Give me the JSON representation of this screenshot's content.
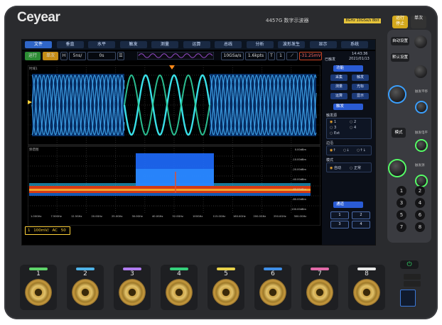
{
  "brand": {
    "name": "Ceyear"
  },
  "model": {
    "title": "4457G 数字示波器",
    "badge": "8GHz 10GSa/s 8bit"
  },
  "hw_buttons": {
    "run_stop": "运行\n停止",
    "single": "单次"
  },
  "menu": [
    {
      "label": "文件",
      "active": true
    },
    {
      "label": "垂直"
    },
    {
      "label": "水平"
    },
    {
      "label": "触发"
    },
    {
      "label": "测量"
    },
    {
      "label": "运算"
    },
    {
      "label": "总线"
    },
    {
      "label": "分析"
    },
    {
      "label": "波形发生"
    },
    {
      "label": "显示"
    },
    {
      "label": "系统"
    }
  ],
  "status": {
    "run": "运行",
    "single": "单次",
    "h": "H",
    "timebase": "5ns/",
    "delay": "0s",
    "sample_rate": "10GSa/s",
    "memory": "1.6kpts",
    "trigger_t": "T",
    "trigger_ch": "1",
    "trigger_level": "-31.25mV"
  },
  "plots": {
    "time_label": "时域1",
    "freq_label": "频谱图",
    "freq_axis": [
      "1.00GHz",
      "7.50GHz",
      "12.5GHz",
      "20.0GHz",
      "25.0GHz",
      "30.0GHz",
      "40.0GHz",
      "52.0GHz",
      "100GHz",
      "115.0GHz",
      "160.0GHz",
      "200.0GHz",
      "250.0GHz",
      "300.0GHz"
    ],
    "db_axis": [
      "0.00dBm",
      "-10.00dBm",
      "-20.00dBm",
      "-40.00dBm",
      "-60.00dBm",
      "-80.00dBm",
      "-100.00dBm"
    ]
  },
  "right_panel": {
    "header_status": "已触发",
    "time": "14:43:36",
    "date": "2021/01/13",
    "func_header": "功能",
    "func_buttons": [
      "采集",
      "触发",
      "测量",
      "光标",
      "运算",
      "显示"
    ],
    "trigger_header": "触发",
    "trig_source_label": "触发源",
    "sources": [
      "1",
      "2",
      "3",
      "4",
      "Ext"
    ],
    "edge_label": "边沿",
    "edge_options": [
      "↑",
      "↓",
      "↑↓"
    ],
    "mode_label": "模式",
    "mode_options": [
      "自动",
      "正常"
    ],
    "channel_header": "通道",
    "channel_buttons": [
      "1",
      "2",
      "3",
      "4"
    ]
  },
  "channel_info": {
    "ch": "1",
    "scale": "100mV/",
    "coupling": "AC",
    "impedance": "50"
  },
  "side_labels": {
    "auto": "自动设置",
    "default": "默认设置",
    "mode": "模式",
    "h_label": "触发平移",
    "v_label": "触发电平",
    "v2": "触发源"
  },
  "num_buttons": [
    "1",
    "2",
    "3",
    "4",
    "5",
    "6",
    "7",
    "8"
  ],
  "channels": [
    {
      "num": "1",
      "color": "#5fd46a"
    },
    {
      "num": "2",
      "color": "#4fb3e8"
    },
    {
      "num": "3",
      "color": "#b07cf0"
    },
    {
      "num": "4",
      "color": "#35d07b"
    },
    {
      "num": "5",
      "color": "#e8d24a"
    },
    {
      "num": "6",
      "color": "#3f8fe8"
    },
    {
      "num": "7",
      "color": "#e26aa8"
    },
    {
      "num": "8",
      "color": "#e8e8e8"
    }
  ],
  "colors": {
    "accent": "#2f66c8",
    "trace_ch1": "#ffd23a",
    "trace_blue": "#1e8bff",
    "trace_cyan": "#39e0e8"
  }
}
